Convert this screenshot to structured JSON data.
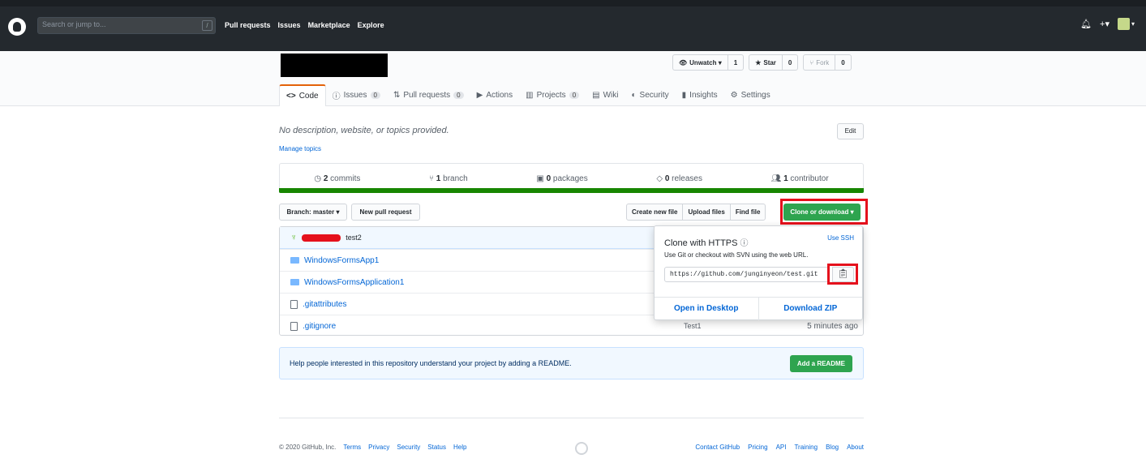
{
  "topbar": {
    "search_placeholder": "Search or jump to...",
    "search_key": "/",
    "nav": [
      "Pull requests",
      "Issues",
      "Marketplace",
      "Explore"
    ]
  },
  "repo_actions": {
    "unwatch_label": "Unwatch ▾",
    "unwatch_count": "1",
    "star_label": "Star",
    "star_count": "0",
    "fork_label": "Fork",
    "fork_count": "0"
  },
  "tabs": [
    {
      "label": "Code",
      "icon": "code-icon",
      "count": ""
    },
    {
      "label": "Issues",
      "icon": "issue-icon",
      "count": "0"
    },
    {
      "label": "Pull requests",
      "icon": "pr-icon",
      "count": "0"
    },
    {
      "label": "Actions",
      "icon": "play-icon",
      "count": ""
    },
    {
      "label": "Projects",
      "icon": "project-icon",
      "count": "0"
    },
    {
      "label": "Wiki",
      "icon": "book-icon",
      "count": ""
    },
    {
      "label": "Security",
      "icon": "shield-icon",
      "count": ""
    },
    {
      "label": "Insights",
      "icon": "graph-icon",
      "count": ""
    },
    {
      "label": "Settings",
      "icon": "gear-icon",
      "count": ""
    }
  ],
  "about": {
    "description": "No description, website, or topics provided.",
    "manage_topics": "Manage topics",
    "edit": "Edit"
  },
  "summary": {
    "commits_n": "2",
    "commits": " commits",
    "branch_n": "1",
    "branch": " branch",
    "packages_n": "0",
    "packages": " packages",
    "releases_n": "0",
    "releases": " releases",
    "contrib_n": "1",
    "contrib": " contributor"
  },
  "toolbar": {
    "branch": "Branch: master ▾",
    "new_pr": "New pull request",
    "create_file": "Create new file",
    "upload": "Upload files",
    "find": "Find file",
    "clone": "Clone or download ▾"
  },
  "commit": {
    "message": "test2"
  },
  "files": [
    {
      "name": "WindowsFormsApp1",
      "type": "folder",
      "msg": "",
      "age": ""
    },
    {
      "name": "WindowsFormsApplication1",
      "type": "folder",
      "msg": "",
      "age": ""
    },
    {
      "name": ".gitattributes",
      "type": "file",
      "msg": "",
      "age": ""
    },
    {
      "name": ".gitignore",
      "type": "file",
      "msg": "Test1",
      "age": "5 minutes ago"
    }
  ],
  "clone_popover": {
    "title": "Clone with HTTPS",
    "use_ssh": "Use SSH",
    "help": "Use Git or checkout with SVN using the web URL.",
    "url": "https://github.com/junginyeon/test.git",
    "open_desktop": "Open in Desktop",
    "download_zip": "Download ZIP"
  },
  "readme": {
    "text": "Help people interested in this repository understand your project by adding a README.",
    "button": "Add a README"
  },
  "footer": {
    "copyright": "© 2020 GitHub, Inc.",
    "left_links": [
      "Terms",
      "Privacy",
      "Security",
      "Status",
      "Help"
    ],
    "right_links": [
      "Contact GitHub",
      "Pricing",
      "API",
      "Training",
      "Blog",
      "About"
    ]
  },
  "colors": {
    "accent_green": "#2ea44f",
    "highlight_red": "#e5111c",
    "link_blue": "#0366d6"
  }
}
